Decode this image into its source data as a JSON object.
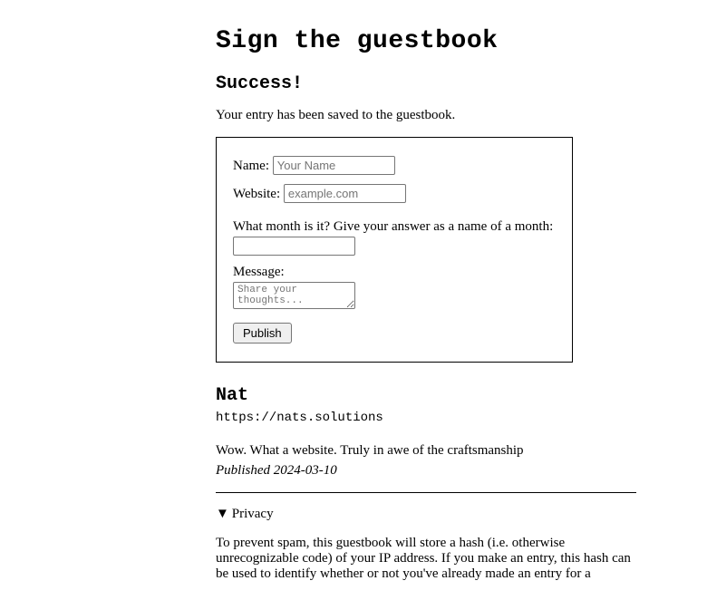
{
  "page": {
    "title": "Sign the guestbook",
    "success_heading": "Success!",
    "success_message": "Your entry has been saved to the guestbook."
  },
  "form": {
    "name_label": "Name:",
    "name_placeholder": "Your Name",
    "name_value": "",
    "website_label": "Website:",
    "website_placeholder": "example.com",
    "website_value": "",
    "captcha_label": "What month is it? Give your answer as a name of a month:",
    "captcha_value": "",
    "message_label": "Message:",
    "message_placeholder": "Share your thoughts...",
    "message_value": "",
    "publish_label": "Publish"
  },
  "entry": {
    "author": "Nat",
    "url": "https://nats.solutions",
    "message": "Wow. What a website. Truly in awe of the craftsmanship",
    "date_prefix": "Published ",
    "date": "2024-03-10"
  },
  "privacy": {
    "marker": "▼",
    "label": "Privacy",
    "body": "To prevent spam, this guestbook will store a hash (i.e. otherwise unrecognizable code) of your IP address. If you make an entry, this hash can be used to identify whether or not you've already made an entry for a"
  }
}
